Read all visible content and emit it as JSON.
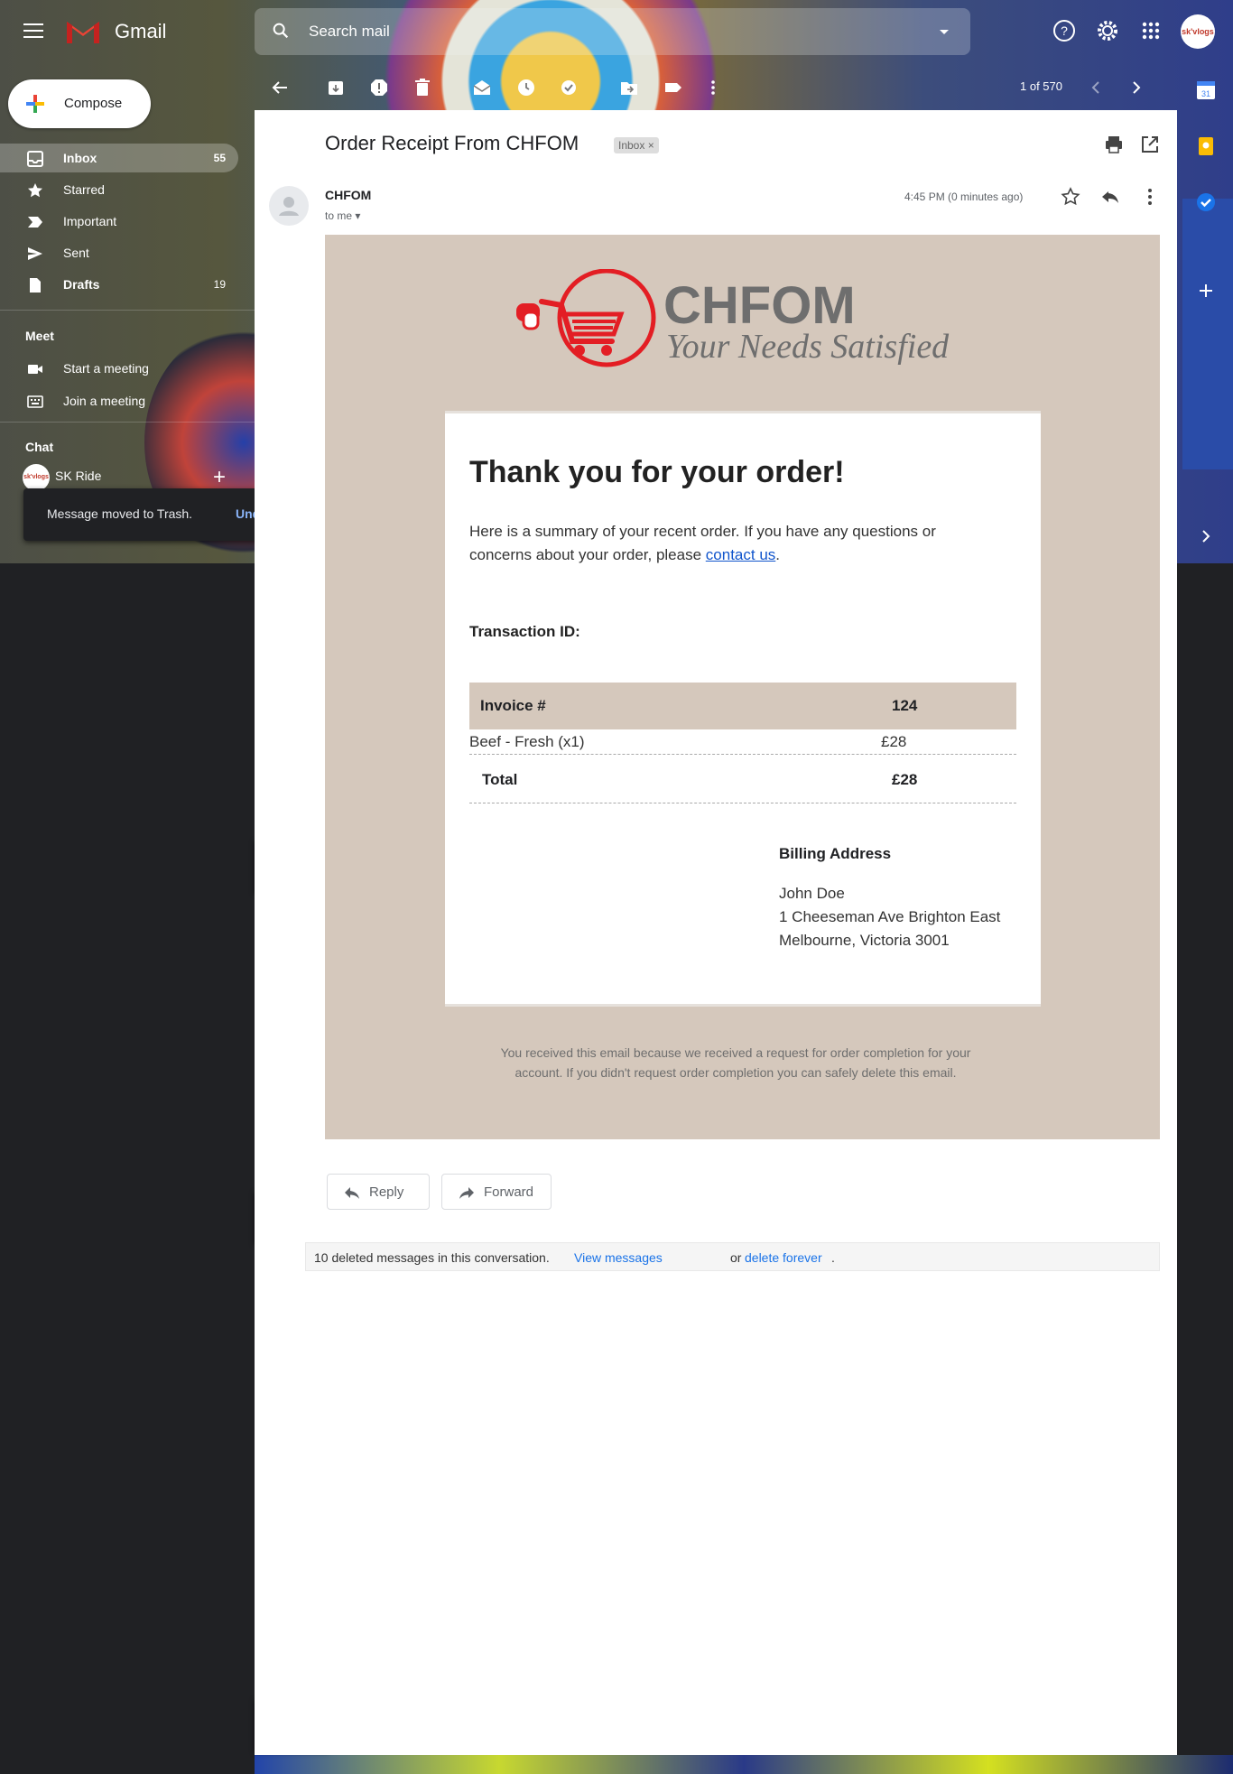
{
  "header": {
    "app_name": "Gmail",
    "search_placeholder": "Search mail",
    "account_avatar": "sk'vlogs"
  },
  "sidebar": {
    "compose_label": "Compose",
    "items": [
      {
        "label": "Inbox",
        "count": "55",
        "icon": "inbox-icon",
        "active": true,
        "bold": true
      },
      {
        "label": "Starred",
        "count": "",
        "icon": "star-icon"
      },
      {
        "label": "Important",
        "count": "",
        "icon": "important-icon"
      },
      {
        "label": "Sent",
        "count": "",
        "icon": "send-icon"
      },
      {
        "label": "Drafts",
        "count": "19",
        "icon": "draft-icon",
        "bold": true
      }
    ],
    "meet": {
      "title": "Meet",
      "start": "Start a meeting",
      "join": "Join a meeting"
    },
    "chat": {
      "title": "Chat",
      "user": "SK Ride",
      "avatar": "sk'vlogs"
    }
  },
  "snackbar": {
    "text": "Message moved to Trash.",
    "undo": "Undo",
    "undo_partial": "do"
  },
  "toolbar": {
    "pager": "1 of 570"
  },
  "message": {
    "subject": "Order Receipt From CHFOM",
    "label": "Inbox",
    "sender": "CHFOM",
    "recipient": "to me",
    "time": "4:45 PM (0 minutes ago)"
  },
  "email": {
    "brand": "CHFOM",
    "tagline": "Your Needs Satisfied",
    "heading": "Thank you for your order!",
    "intro_text": "Here is a summary of your recent order. If you have any questions or concerns about your order, please ",
    "intro_link": "contact us",
    "intro_end": ".",
    "transaction_label": "Transaction ID:",
    "invoice_label": "Invoice #",
    "invoice_number": "124",
    "item_name": "Beef - Fresh (x1)",
    "item_price": "£28",
    "total_label": "Total",
    "total_value": "£28",
    "billing_title": "Billing Address",
    "billing_name": "John Doe",
    "billing_street": "1 Cheeseman Ave Brighton East",
    "billing_city": "Melbourne, Victoria 3001",
    "footer_line1": "You received this email because we received a request for order completion for your",
    "footer_line2": "account. If you didn't request order completion you can safely delete this email."
  },
  "actions": {
    "reply": "Reply",
    "forward": "Forward"
  },
  "deleted_notice": {
    "text": "10 deleted messages in this conversation.",
    "view": "View messages",
    "or": "or",
    "delete": "delete forever",
    "end": "."
  },
  "colors": {
    "email_bg": "#d5c8bc",
    "brand_red": "#e31e24",
    "brand_gray": "#6e6e6e",
    "link_blue": "#1a73e8"
  }
}
